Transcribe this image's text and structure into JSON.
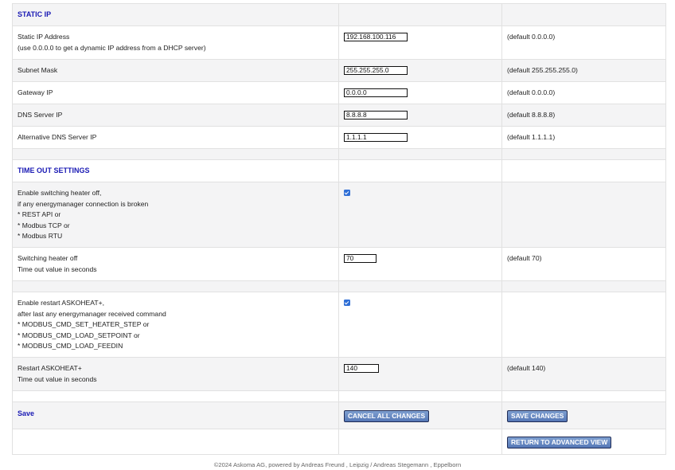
{
  "static_ip": {
    "heading": "STATIC IP",
    "rows": [
      {
        "label1": "Static IP Address",
        "label2": "(use 0.0.0.0 to get a dynamic IP address from a DHCP server)",
        "value": "192.168.100.116",
        "default": "(default 0.0.0.0)"
      },
      {
        "label1": "Subnet Mask",
        "value": "255.255.255.0",
        "default": "(default 255.255.255.0)"
      },
      {
        "label1": "Gateway IP",
        "value": "0.0.0.0",
        "default": "(default 0.0.0.0)"
      },
      {
        "label1": "DNS Server IP",
        "value": "8.8.8.8",
        "default": "(default 8.8.8.8)"
      },
      {
        "label1": "Alternative DNS Server IP",
        "value": "1.1.1.1",
        "default": "(default 1.1.1.1)"
      }
    ]
  },
  "timeout": {
    "heading": "TIME OUT SETTINGS",
    "enable_off": {
      "lines": [
        "Enable switching heater off,",
        "if any energymanager connection is broken",
        "* REST API or",
        "* Modbus TCP or",
        "* Modbus RTU"
      ],
      "checked": true
    },
    "switch_off": {
      "label1": "Switching heater off",
      "label2": "Time out value in seconds",
      "value": "70",
      "default": "(default 70)"
    },
    "enable_restart": {
      "lines": [
        "Enable restart ASKOHEAT+,",
        "after last any energymanager received command",
        "* MODBUS_CMD_SET_HEATER_STEP or",
        "* MODBUS_CMD_LOAD_SETPOINT or",
        "* MODBUS_CMD_LOAD_FEEDIN"
      ],
      "checked": true
    },
    "restart": {
      "label1": "Restart ASKOHEAT+",
      "label2": "Time out value in seconds",
      "value": "140",
      "default": "(default 140)"
    }
  },
  "save": {
    "heading": "Save",
    "cancel_label": "CANCEL ALL CHANGES",
    "save_label": "SAVE CHANGES",
    "return_label": "RETURN TO ADVANCED VIEW"
  },
  "footer": "©2024 Askoma AG, powered by Andreas Freund , Leipzig / Andreas Stegemann , Eppelborn"
}
